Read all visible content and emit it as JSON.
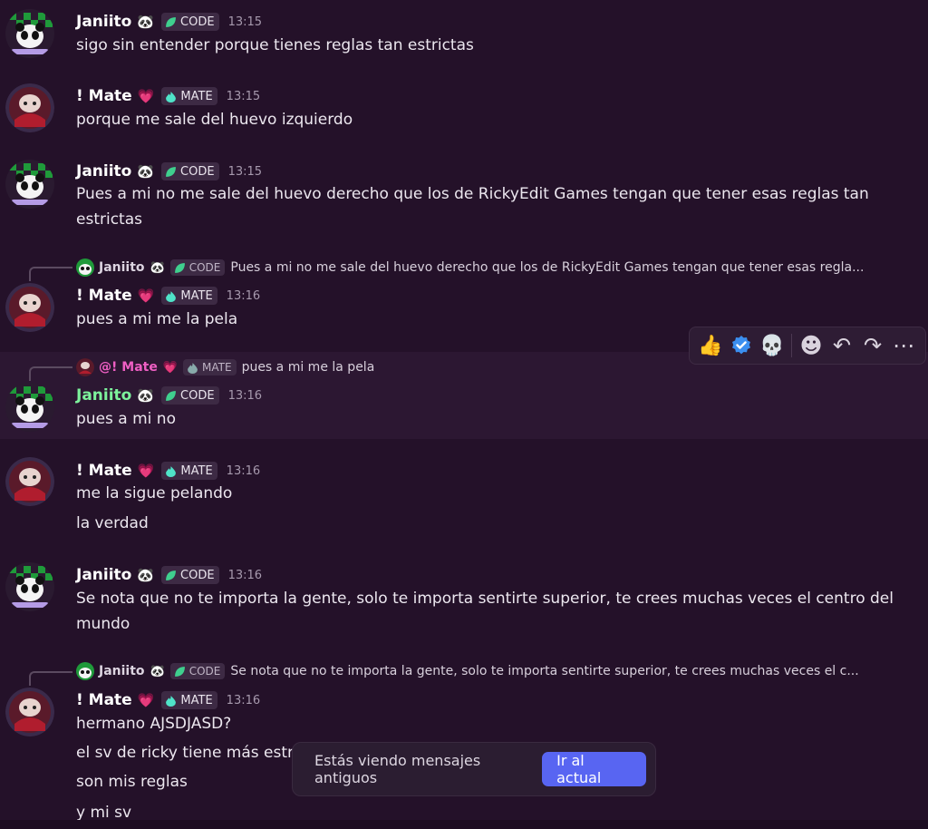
{
  "users": {
    "janiito": {
      "name": "Janiito",
      "emoji": "🐼",
      "tag": "CODE",
      "tag_color": "#3fcf8e"
    },
    "mate": {
      "name": "! Mate",
      "emoji": "💗",
      "tag": "MATE",
      "tag_color": "#4fe3c8",
      "mention": "@! Mate"
    }
  },
  "messages": [
    {
      "time": "13:15",
      "lines": [
        "sigo sin entender porque tienes reglas tan estrictas"
      ]
    },
    {
      "time": "13:15",
      "lines": [
        "porque me sale del huevo izquierdo"
      ]
    },
    {
      "time": "13:15",
      "lines": [
        "Pues a mi no me sale del huevo derecho que los de RickyEdit Games tengan que tener esas reglas tan",
        "estrictas"
      ]
    },
    {
      "time": "13:16",
      "reply_text": "Pues a mi no me sale del huevo derecho que los de RickyEdit Games tengan que tener esas regla...",
      "lines": [
        "pues a mi me la pela"
      ]
    },
    {
      "time": "13:16",
      "reply_text": "pues a mi me la pela",
      "lines": [
        "pues a mi no"
      ]
    },
    {
      "time": "13:16",
      "lines": [
        "me la sigue pelando",
        "la verdad"
      ]
    },
    {
      "time": "13:16",
      "lines": [
        "Se nota que no te importa la gente, solo te importa sentirte superior, te crees muchas veces el centro del",
        "mundo"
      ]
    },
    {
      "time": "13:16",
      "reply_text": "Se nota que no te importa la gente, solo te importa sentirte superior, te crees muchas veces el c...",
      "lines": [
        "hermano AJSDJASD?",
        "el sv de ricky tiene más estri",
        "son mis reglas",
        "y mi sv"
      ]
    }
  ],
  "hover_actions": [
    "thumbs-up",
    "verified",
    "skull",
    "add-reaction",
    "reply",
    "forward",
    "more"
  ],
  "hover_glyphs": {
    "thumbs": "👍",
    "skull": "💀",
    "smile": "☻",
    "reply": "↶",
    "forward": "↷",
    "more": "⋯"
  },
  "toast": {
    "text": "Estás viendo mensajes antiguos",
    "button": "Ir al actual",
    "button_color": "#5865f2"
  }
}
